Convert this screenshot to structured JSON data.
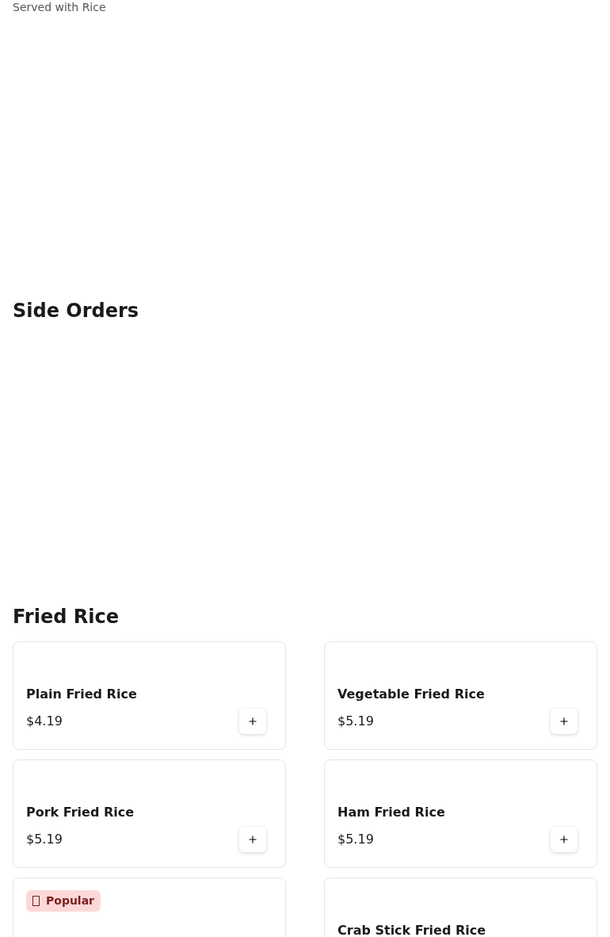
{
  "intro": "Served with Rice",
  "sections": [
    {
      "title": "Side Orders"
    },
    {
      "title": "Fried Rice",
      "items": [
        {
          "name": "Plain Fried Rice",
          "price": "$4.19",
          "popular": false
        },
        {
          "name": "Vegetable Fried Rice",
          "price": "$5.19",
          "popular": false
        },
        {
          "name": "Pork Fried Rice",
          "price": "$5.19",
          "popular": false
        },
        {
          "name": "Ham Fried Rice",
          "price": "$5.19",
          "popular": false
        },
        {
          "popular": true,
          "badge": "Popular"
        },
        {
          "name": "Crab Stick Fried Rice",
          "popular": false
        }
      ]
    }
  ]
}
